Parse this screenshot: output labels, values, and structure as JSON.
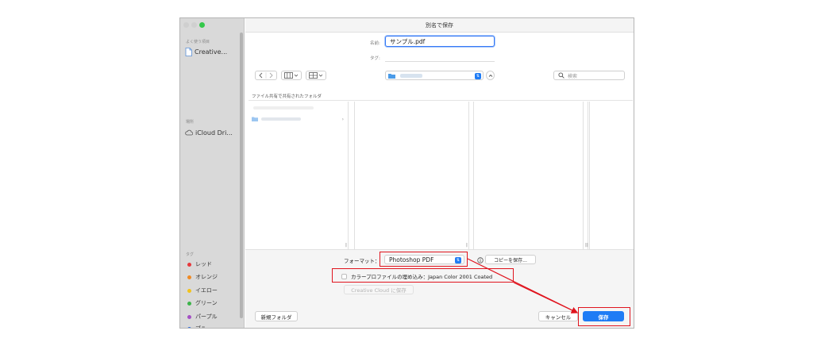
{
  "window": {
    "title": "別名で保存"
  },
  "sidebar": {
    "favorites_heading": "よく使う項目",
    "favorites": [
      {
        "label": "Creative...",
        "icon": "document-icon"
      }
    ],
    "locations_heading": "場所",
    "locations": [
      {
        "label": "iCloud Dri...",
        "icon": "cloud-icon"
      }
    ],
    "tags_heading": "タグ",
    "tags": [
      {
        "label": "レッド",
        "color": "#e6383c"
      },
      {
        "label": "オレンジ",
        "color": "#f08a24"
      },
      {
        "label": "イエロー",
        "color": "#f2c21b"
      },
      {
        "label": "グリーン",
        "color": "#3cb34a"
      },
      {
        "label": "パープル",
        "color": "#a450c4"
      },
      {
        "label": "ブル",
        "color": "#2f6fe0"
      }
    ]
  },
  "form": {
    "name_label": "名前:",
    "name_value": "サンプル.pdf",
    "tag_label": "タグ:",
    "tag_value": ""
  },
  "toolbar": {
    "back_icon": "chevron-left-icon",
    "forward_icon": "chevron-right-icon",
    "view_columns_icon": "columns-icon",
    "group_icon": "grid-icon",
    "location_value": "",
    "search_placeholder": "検索"
  },
  "browser": {
    "section_header": "ファイル共有で共有されたフォルダ"
  },
  "options": {
    "format_label": "フォーマット：",
    "format_value": "Photoshop PDF",
    "copy_label": "コピーを保存...",
    "embed_profile_label": "カラープロファイルの埋め込み：Japan Color 2001 Coated",
    "embed_profile_checked": false,
    "creative_cloud_label": "Creative Cloud に保存"
  },
  "footer": {
    "new_folder_label": "新規フォルダ",
    "cancel_label": "キャンセル",
    "save_label": "保存"
  },
  "colors": {
    "accent": "#1f7cf5",
    "highlight_box": "#e0141e"
  }
}
